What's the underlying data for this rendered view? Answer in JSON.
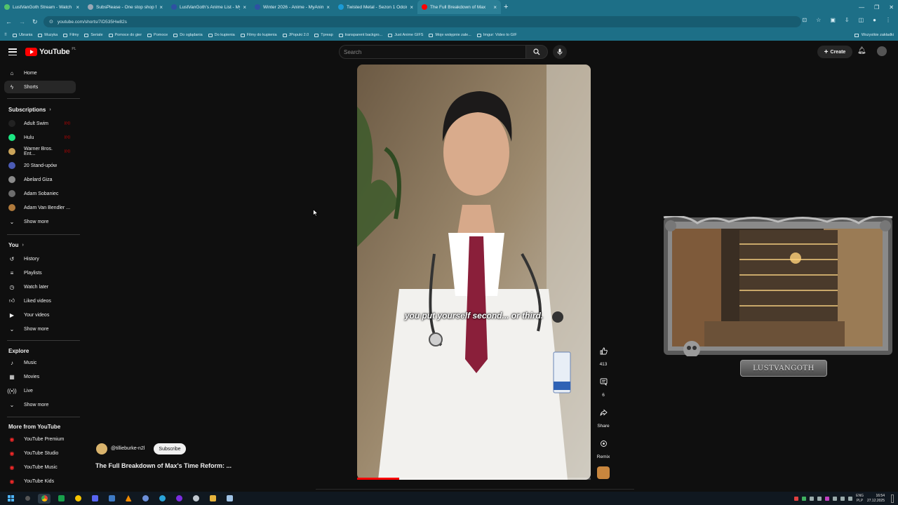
{
  "browser": {
    "tabs": [
      {
        "title": "LustVanGoth Stream - Watch L",
        "color": "#53c46b"
      },
      {
        "title": "SubsPlease - One stop shop fo",
        "color": "#9aa7b5"
      },
      {
        "title": "LustVanGoth's Anime List - My",
        "color": "#2e51a2"
      },
      {
        "title": "Winter 2026 - Anime - MyAnim",
        "color": "#2e51a2"
      },
      {
        "title": "Twisted Metal - Sezon 1 Odcin",
        "color": "#1b9bd6"
      },
      {
        "title": "The Full Breakdown of Max",
        "color": "#ff0000"
      }
    ],
    "url": "youtube.com/shorts/7iD535Hw82s",
    "bookmarks": [
      "Ubrania",
      "Muzyka",
      "Filmy",
      "Seriale",
      "Pomoce do gier",
      "Pomoce",
      "Do oglądania",
      "Do kupienia",
      "Filmy do kupienia",
      "JPopuki 2.0",
      "Tpreap",
      "transparent backgro...",
      "Just Anime GIFS",
      "Moje wstępnie zale...",
      "Imgur: Video to GIF"
    ],
    "bookmarks_right": "Wszystkie zakładki"
  },
  "header": {
    "logo_text": "YouTube",
    "logo_country": "PL",
    "search_placeholder": "Search",
    "create_label": "Create"
  },
  "sidebar": {
    "main": [
      {
        "label": "Home",
        "icon": "home-icon"
      },
      {
        "label": "Shorts",
        "icon": "shorts-icon"
      }
    ],
    "subscriptions_title": "Subscriptions",
    "subscriptions": [
      {
        "label": "Adult Swim",
        "color": "#222222",
        "live": true
      },
      {
        "label": "Hulu",
        "color": "#1ce783",
        "live": true
      },
      {
        "label": "Warner Bros. Ent...",
        "color": "#caa45a",
        "live": true
      },
      {
        "label": "20 Stand-upów",
        "color": "#4b5bb5",
        "live": false
      },
      {
        "label": "Abelard Giza",
        "color": "#8a8a8a",
        "live": false
      },
      {
        "label": "Adam Sobaniec",
        "color": "#6d6d6d",
        "live": false
      },
      {
        "label": "Adam Van Bendler ...",
        "color": "#b07a3c",
        "live": false
      }
    ],
    "show_more": "Show more",
    "you_title": "You",
    "you_items": [
      {
        "label": "History",
        "icon": "history-icon"
      },
      {
        "label": "Playlists",
        "icon": "playlists-icon"
      },
      {
        "label": "Watch later",
        "icon": "watch-later-icon"
      },
      {
        "label": "Liked videos",
        "icon": "liked-videos-icon"
      },
      {
        "label": "Your videos",
        "icon": "your-videos-icon"
      }
    ],
    "explore_title": "Explore",
    "explore_items": [
      {
        "label": "Music",
        "icon": "music-icon"
      },
      {
        "label": "Movies",
        "icon": "movies-icon"
      },
      {
        "label": "Live",
        "icon": "live-icon"
      }
    ],
    "more_title": "More from YouTube",
    "more_items": [
      {
        "label": "YouTube Premium"
      },
      {
        "label": "YouTube Studio"
      },
      {
        "label": "YouTube Music"
      },
      {
        "label": "YouTube Kids"
      }
    ]
  },
  "video": {
    "subtitle": "you put yourself second... or third.",
    "progress": 0.18,
    "channel": "@tillieburke-n2l",
    "subscribe_label": "Subscribe",
    "title": "The Full Breakdown of Max's Time Reform: ..."
  },
  "actions": {
    "likes": "413",
    "comments": "6",
    "share_label": "Share",
    "remix_label": "Remix"
  },
  "overlay": {
    "label": "LUSTVANGOTH"
  },
  "taskbar": {
    "lang": "ENG",
    "lang2": "PLP",
    "time": "16:54",
    "date": "27.12.2025"
  }
}
